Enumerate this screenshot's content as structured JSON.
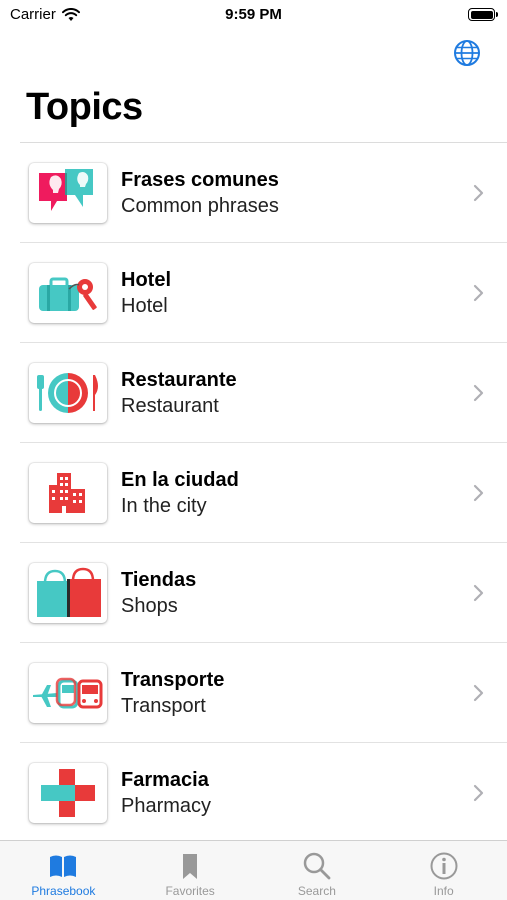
{
  "status_bar": {
    "carrier": "Carrier",
    "time": "9:59 PM"
  },
  "header": {
    "title": "Topics",
    "globe_icon": "globe-icon"
  },
  "topics": [
    {
      "title": "Frases comunes",
      "subtitle": "Common phrases",
      "icon": "speech-bubbles-icon"
    },
    {
      "title": "Hotel",
      "subtitle": "Hotel",
      "icon": "suitcase-key-icon"
    },
    {
      "title": "Restaurante",
      "subtitle": "Restaurant",
      "icon": "plate-cutlery-icon"
    },
    {
      "title": "En la ciudad",
      "subtitle": "In the city",
      "icon": "building-icon"
    },
    {
      "title": "Tiendas",
      "subtitle": "Shops",
      "icon": "shopping-bags-icon"
    },
    {
      "title": "Transporte",
      "subtitle": "Transport",
      "icon": "transport-icon"
    },
    {
      "title": "Farmacia",
      "subtitle": "Pharmacy",
      "icon": "pharmacy-cross-icon"
    }
  ],
  "tabs": [
    {
      "label": "Phrasebook",
      "icon": "book-icon",
      "active": true
    },
    {
      "label": "Favorites",
      "icon": "bookmark-icon",
      "active": false
    },
    {
      "label": "Search",
      "icon": "search-icon",
      "active": false
    },
    {
      "label": "Info",
      "icon": "info-icon",
      "active": false
    }
  ],
  "colors": {
    "accent": "#1f7be0",
    "teal": "#46c8c4",
    "red": "#e83a3a",
    "pink": "#ef1b5e"
  }
}
